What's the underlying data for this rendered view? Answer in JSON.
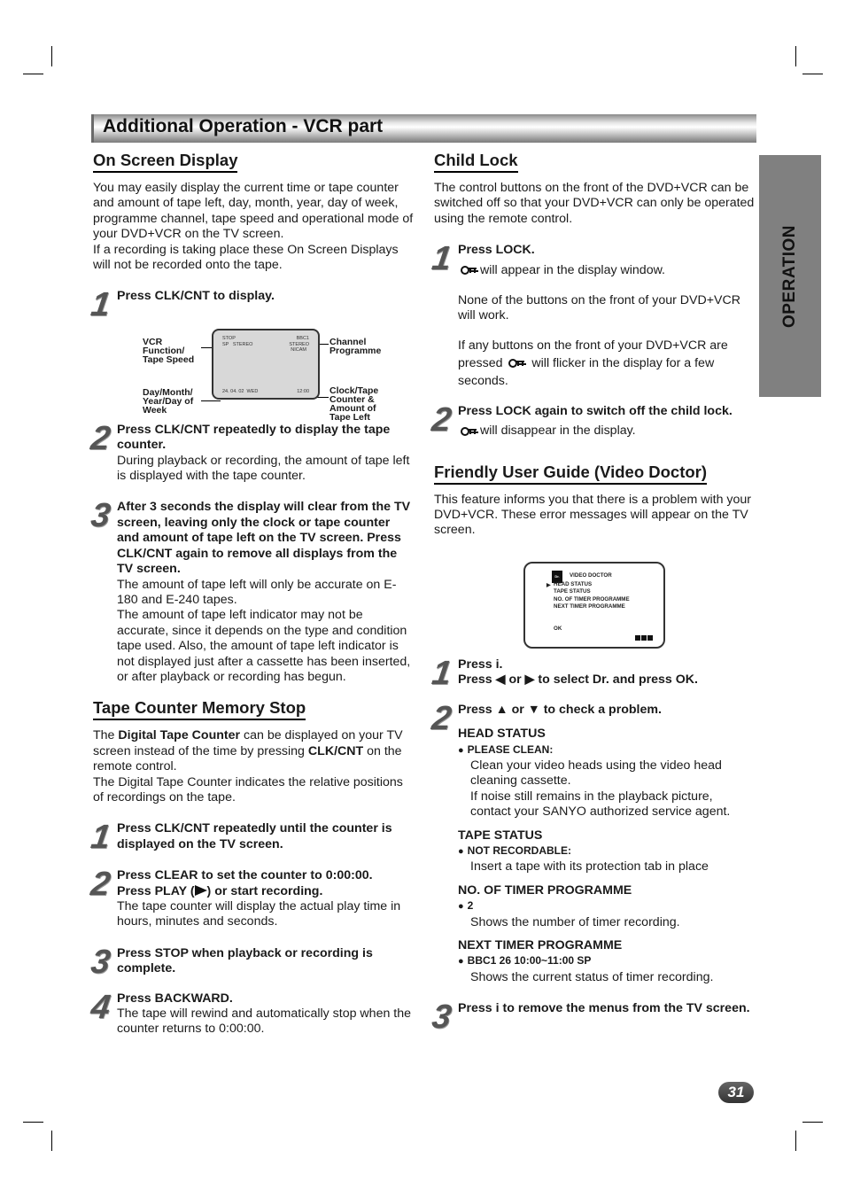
{
  "page": {
    "title": "Additional Operation - VCR part",
    "side_tab": "OPERATION",
    "page_number": "31"
  },
  "on_screen_display": {
    "heading": "On Screen Display",
    "intro": "You may easily display the current time or tape counter and amount of tape left, day, month, year, day of week, programme channel, tape speed and operational mode of your DVD+VCR on the TV screen.",
    "intro2": "If a recording is taking place these On Screen Displays will not be recorded onto the tape.",
    "steps": [
      {
        "num": "1",
        "bold": "Press CLK/CNT to display.",
        "text": ""
      },
      {
        "num": "2",
        "bold": "Press CLK/CNT repeatedly to display the tape counter.",
        "text": "During playback or recording, the amount of tape left is displayed with the tape counter."
      },
      {
        "num": "3",
        "bold": "After 3 seconds the display will clear from the TV screen, leaving only the clock or tape counter and amount of tape left on the TV screen. Press CLK/CNT again to remove all displays from the TV screen.",
        "text": "The amount of tape left will only be accurate on E-180 and E-240 tapes.",
        "text2": "The amount of tape left indicator may not be accurate, since it depends on the type and condition tape used. Also, the amount of tape left indicator is not displayed just after a cassette has been inserted, or after playback or recording has begun."
      }
    ],
    "diagram": {
      "labels": {
        "vcr_function": "VCR Function/ Tape Speed",
        "channel": "Channel Programme",
        "date": "Day/Month/ Year/Day of Week",
        "clock": "Clock/Tape Counter & Amount of Tape Left"
      },
      "screen": {
        "mode": "STOP",
        "speed_audio": "SP   STEREO",
        "channel": "BBC1",
        "audio1": "STEREO",
        "audio2": "NICAM",
        "date": "24. 04. 02  WED",
        "time": "12:00"
      }
    }
  },
  "tape_counter": {
    "heading": "Tape Counter Memory Stop",
    "intro_pre": "The ",
    "intro_bold1": "Digital Tape Counter",
    "intro_mid": " can be displayed on your TV screen instead of the time by pressing ",
    "intro_bold2": "CLK/CNT",
    "intro_post": " on the remote control.",
    "intro2": "The Digital Tape Counter indicates the relative positions of recordings on the tape.",
    "steps": [
      {
        "num": "1",
        "bold": "Press CLK/CNT repeatedly until the counter is displayed on the TV screen.",
        "text": ""
      },
      {
        "num": "2",
        "bold": "Press CLEAR to set the counter to 0:00:00.",
        "bold2_pre": "Press PLAY (",
        "bold2_post": ") or start recording.",
        "text": "The tape counter will display the actual play time in hours, minutes and seconds."
      },
      {
        "num": "3",
        "bold": "Press STOP when playback or recording is complete.",
        "text": ""
      },
      {
        "num": "4",
        "bold": "Press BACKWARD.",
        "text": "The tape will rewind and automatically stop when the counter returns to 0:00:00."
      }
    ]
  },
  "child_lock": {
    "heading": "Child Lock",
    "intro": "The control buttons on the front of the DVD+VCR can be switched off so that your DVD+VCR can only be operated using the remote control.",
    "steps": [
      {
        "num": "1",
        "bold": "Press LOCK.",
        "text": "will appear in the display window.",
        "text2": "None of the buttons on the front of your DVD+VCR will work.",
        "text3_pre": "If any buttons on the front of your DVD+VCR are pressed",
        "text3_post": "will flicker in the display for a few seconds."
      },
      {
        "num": "2",
        "bold": "Press LOCK again to switch off the child lock.",
        "text": "will disappear in the display."
      }
    ]
  },
  "video_doctor": {
    "heading": "Friendly User Guide (Video Doctor)",
    "intro": "This feature informs you that there is a problem with your DVD+VCR. These error messages will appear on the TV screen.",
    "screen": {
      "title": "VIDEO DOCTOR",
      "icon_label": "Dr.",
      "items": [
        "HEAD STATUS",
        "TAPE STATUS",
        "NO. OF TIMER PROGRAMME",
        "NEXT TIMER PROGRAMME"
      ],
      "ok": "OK"
    },
    "steps": [
      {
        "num": "1",
        "bold": "Press i.",
        "bold2": "Press ◀ or ▶ to select Dr. and press OK."
      },
      {
        "num": "2",
        "bold": "Press ▲ or ▼ to check a problem."
      },
      {
        "num": "3",
        "bold": "Press i to remove the menus from the TV screen."
      }
    ],
    "problems": [
      {
        "title": "HEAD STATUS",
        "bullet": "PLEASE CLEAN:",
        "text": "Clean your video heads using the video head cleaning cassette.",
        "text2": "If noise still remains in the playback picture, contact your SANYO authorized service agent."
      },
      {
        "title": "TAPE STATUS",
        "bullet": "NOT RECORDABLE:",
        "text": "Insert a tape with its protection tab in place"
      },
      {
        "title": "NO. OF TIMER PROGRAMME",
        "bullet": "2",
        "text": "Shows the number of timer recording."
      },
      {
        "title": "NEXT TIMER PROGRAMME",
        "bullet": "BBC1 26 10:00~11:00 SP",
        "text": "Shows the current status of timer recording."
      }
    ]
  }
}
